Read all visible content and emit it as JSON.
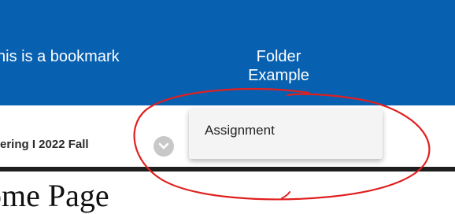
{
  "navbar": {
    "bookmark_label": "his is a bookmark",
    "folder_label_line1": "Folder",
    "folder_label_line2": "Example",
    "background": "#0760b0"
  },
  "course": {
    "title": "ering I 2022 Fall"
  },
  "dropdown": {
    "items": [
      {
        "label": "Assignment"
      }
    ]
  },
  "page": {
    "title": "ome Page"
  },
  "annotation": {
    "color": "#e02020",
    "shape": "hand-drawn ellipse"
  },
  "icons": {
    "chevron": "chevron-down-icon"
  }
}
